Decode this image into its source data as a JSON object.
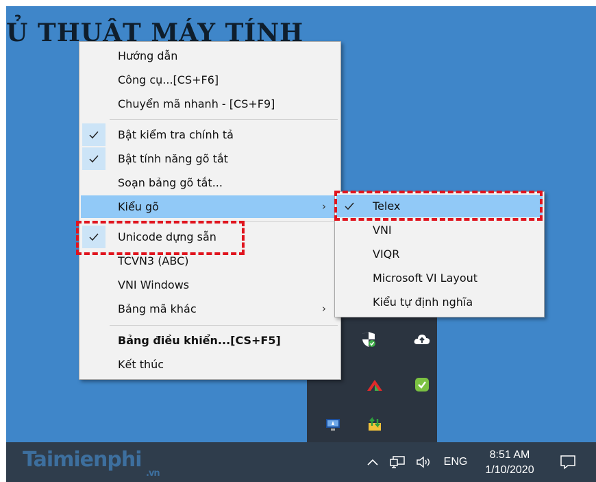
{
  "banner": {
    "text": "Ủ THUẬT MÁY TÍNH"
  },
  "main_menu": {
    "items": [
      {
        "label": "Hướng dẫn",
        "checked": false,
        "submenu": false
      },
      {
        "label": "Công cụ...[CS+F6]",
        "checked": false,
        "submenu": false
      },
      {
        "label": "Chuyển mã nhanh - [CS+F9]",
        "checked": false,
        "submenu": false
      },
      {
        "label": "Bật kiểm tra chính tả",
        "checked": true,
        "submenu": false
      },
      {
        "label": "Bật tính năng gõ tắt",
        "checked": true,
        "submenu": false
      },
      {
        "label": "Soạn bảng gõ tắt...",
        "checked": false,
        "submenu": false
      },
      {
        "label": "Kiểu gõ",
        "checked": false,
        "submenu": true,
        "highlighted": true
      },
      {
        "label": "Unicode dựng sẵn",
        "checked": true,
        "submenu": false
      },
      {
        "label": "TCVN3 (ABC)",
        "checked": false,
        "submenu": false
      },
      {
        "label": "VNI Windows",
        "checked": false,
        "submenu": false
      },
      {
        "label": "Bảng mã khác",
        "checked": false,
        "submenu": true
      },
      {
        "label": "Bảng điều khiển...[CS+F5]",
        "checked": false,
        "submenu": false,
        "bold": true
      },
      {
        "label": "Kết thúc",
        "checked": false,
        "submenu": false
      }
    ]
  },
  "sub_menu": {
    "items": [
      {
        "label": "Telex",
        "checked": true,
        "highlighted": true
      },
      {
        "label": "VNI",
        "checked": false
      },
      {
        "label": "VIQR",
        "checked": false
      },
      {
        "label": "Microsoft VI Layout",
        "checked": false
      },
      {
        "label": "Kiểu tự định nghĩa",
        "checked": false
      }
    ]
  },
  "tray_icons": [
    "security-shield-icon",
    "cloud-upload-icon",
    "red-wing-icon",
    "green-check-icon",
    "unikey-icon",
    "network-sync-icon"
  ],
  "taskbar": {
    "watermark": "Taimienphi",
    "watermark_suffix": ".vn",
    "chevron_icon": "chevron-up-icon",
    "language": "ENG",
    "time": "8:51 AM",
    "date": "1/10/2020"
  },
  "colors": {
    "desktop": "#3f86c9",
    "taskbar": "#2f3d4c",
    "menu_bg": "#f2f2f2",
    "hover": "#91c9f7",
    "check_bg": "#cce4f7",
    "highlight_border": "#e0141e"
  }
}
